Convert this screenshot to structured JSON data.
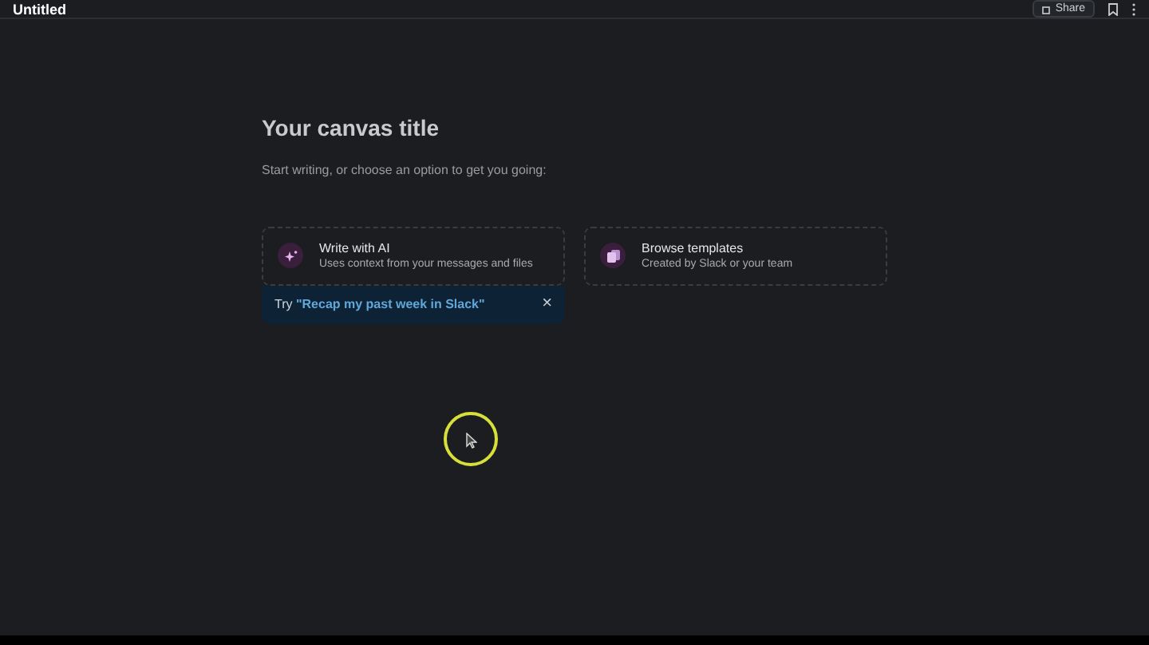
{
  "header": {
    "title": "Untitled",
    "share_label": "Share"
  },
  "canvas": {
    "title": "Your canvas title",
    "subtitle": "Start writing, or choose an option to get you going:"
  },
  "options": [
    {
      "kind": "ai",
      "title": "Write with AI",
      "description": "Uses context from your messages and files"
    },
    {
      "kind": "templates",
      "title": "Browse templates",
      "description": "Created by Slack or your team"
    }
  ],
  "suggestion": {
    "prefix": "Try",
    "prompt": "\"Recap my past week in Slack\"",
    "close": "×"
  }
}
